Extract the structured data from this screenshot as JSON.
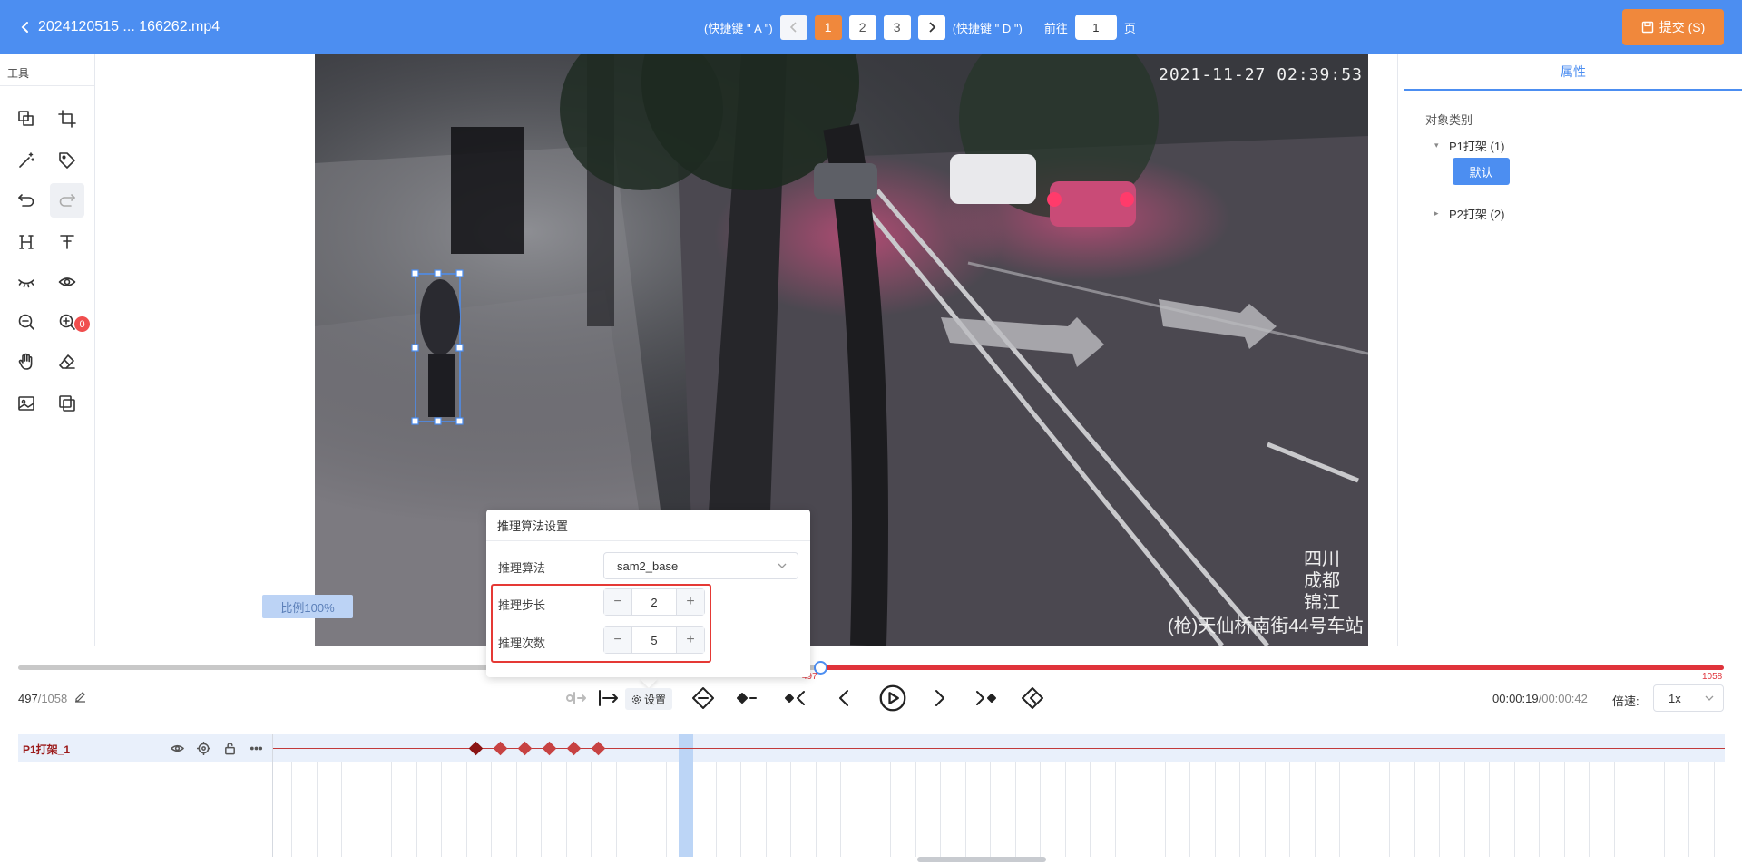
{
  "header": {
    "filename": "2024120515 ... 166262.mp4",
    "prev_hint": "(快捷键 \" A \")",
    "next_hint": "(快捷键 \" D \")",
    "pages": [
      "1",
      "2",
      "3"
    ],
    "active_page": "1",
    "goto_label": "前往",
    "goto_value": "1",
    "page_suffix": "页",
    "submit_label": "提交 (S)"
  },
  "toolbar": {
    "title": "工具",
    "eye_badge": "0",
    "tools": [
      "copy-shape-icon",
      "crop-icon",
      "magic-wand-icon",
      "tag-icon",
      "undo-icon",
      "redo-icon",
      "h-tool-icon",
      "text-tool-icon",
      "eye-closed-icon",
      "eye-icon",
      "zoom-out-icon",
      "zoom-in-icon",
      "hand-icon",
      "eraser-icon",
      "image-icon",
      "layers-icon"
    ]
  },
  "canvas": {
    "scale_label": "比例100%",
    "video_timestamp": "2021-11-27 02:39:53",
    "video_location": [
      "四川",
      "成都",
      "锦江"
    ],
    "video_station": "(枪)天仙桥南街44号车站"
  },
  "properties": {
    "tab_label": "属性",
    "category_label": "对象类别",
    "items": [
      {
        "label": "P1打架 (1)",
        "expanded": true
      },
      {
        "label": "P2打架 (2)",
        "expanded": false
      }
    ],
    "default_button": "默认"
  },
  "popup": {
    "title": "推理算法设置",
    "algo_label": "推理算法",
    "algo_value": "sam2_base",
    "step_label": "推理步长",
    "step_value": "2",
    "count_label": "推理次数",
    "count_value": "5",
    "minus": "−",
    "plus": "+"
  },
  "progress": {
    "current_frame": "497",
    "total_frame": "/1058",
    "marker_label": "497",
    "end_label": "1058",
    "fraction": 0.47
  },
  "controls": {
    "settings_label": "设置",
    "time_current": "00:00:19",
    "time_total": "/00:00:42",
    "speed_label": "倍速:",
    "speed_value": "1x"
  },
  "track": {
    "name": "P1打架_1",
    "keyframes": [
      428,
      455,
      482,
      509,
      536,
      563
    ],
    "colors": {
      "keyframe_first": "#8a1414",
      "keyframe": "#c74242",
      "accent": "#4c8ef1",
      "orange": "#f0883c",
      "red": "#e53935"
    }
  }
}
